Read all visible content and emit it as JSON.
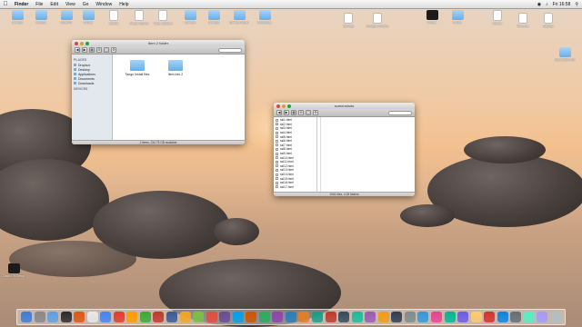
{
  "menubar": {
    "apple": "",
    "items": [
      "Finder",
      "File",
      "Edit",
      "View",
      "Go",
      "Window",
      "Help"
    ],
    "clock": "Fri 16:58"
  },
  "desktop_icons": [
    {
      "label": "Untitled",
      "kind": "folder"
    },
    {
      "label": "Version",
      "kind": "folder"
    },
    {
      "label": "RealYR",
      "kind": "folder"
    },
    {
      "label": "Folder",
      "kind": "folder"
    },
    {
      "label": "Jumble",
      "kind": "doc"
    },
    {
      "label": "Cheat Syntax",
      "kind": "doc"
    },
    {
      "label": "Tube Installer",
      "kind": "doc"
    },
    {
      "label": "Untitled",
      "kind": "folder"
    },
    {
      "label": "Untitled",
      "kind": "folder"
    },
    {
      "label": "Untitled folder",
      "kind": "folder"
    },
    {
      "label": "Webfolder",
      "kind": "folder"
    },
    {
      "label": "Springs",
      "kind": "doc"
    },
    {
      "label": "Google Chrome",
      "kind": "doc"
    },
    {
      "label": "Folder",
      "kind": "dark"
    },
    {
      "label": "Folder",
      "kind": "folder"
    },
    {
      "label": "Server",
      "kind": "doc"
    },
    {
      "label": "Screens",
      "kind": "doc"
    },
    {
      "label": "Backup",
      "kind": "doc"
    },
    {
      "label": "Macintosh HD",
      "kind": "folder"
    },
    {
      "label": "Diablo III Setup",
      "kind": "dark"
    }
  ],
  "window1": {
    "title": "Item 2 folder",
    "sidebar": {
      "favorites_heading": "PLACES",
      "favorites": [
        "Dropbox",
        "Desktop",
        "Applications",
        "Documents",
        "Downloads"
      ],
      "devices_heading": "DEVICES"
    },
    "items": [
      {
        "label": "Tango Install files"
      },
      {
        "label": "Item Info 2"
      }
    ],
    "status": "2 items, 234.75 GB available"
  },
  "window2": {
    "title": "screenshots",
    "rows": [
      "ssl1.html",
      "ssl2.html",
      "ssl3.html",
      "ssl4.html",
      "ssl5.html",
      "ssl6.html",
      "ssl7.html",
      "ssl8.html",
      "ssl9.html",
      "ssl10.html",
      "ssl11.html",
      "ssl12.html",
      "ssl13.html",
      "ssl14.html",
      "ssl15.html",
      "ssl16.html",
      "ssl17.html"
    ],
    "status": "1061 files, 4.18 folders"
  },
  "dock": {
    "colors": [
      "#3d7cd6",
      "#888888",
      "#5ea0e5",
      "#2a2a2a",
      "#dd5511",
      "#e8e8e8",
      "#4285f4",
      "#e33b2e",
      "#ff9c00",
      "#3aaa35",
      "#c0392b",
      "#3b5998",
      "#f5a623",
      "#7bc043",
      "#e74c3c",
      "#6a4c93",
      "#00a2ed",
      "#d35400",
      "#27ae60",
      "#8e44ad",
      "#2980b9",
      "#e67e22",
      "#16a085",
      "#c0392b",
      "#34495e",
      "#1abc9c",
      "#9b59b6",
      "#f39c12",
      "#2c3e50",
      "#7f8c8d",
      "#3498db",
      "#e84393",
      "#00b894",
      "#6c5ce7",
      "#fdcb6e",
      "#d63031",
      "#0984e3",
      "#636e72",
      "#55efc4",
      "#a29bfe",
      "#b2bec3"
    ]
  }
}
